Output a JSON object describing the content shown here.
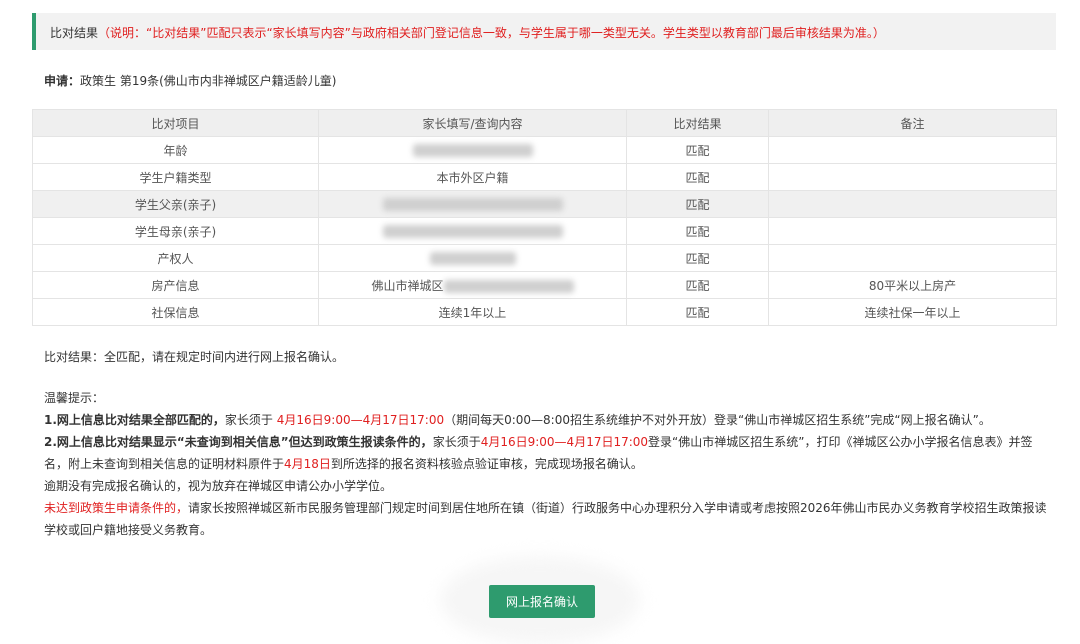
{
  "header": {
    "title": "比对结果",
    "note": "（说明：“比对结果”匹配只表示“家长填写内容”与政府相关部门登记信息一致，与学生属于哪一类型无关。学生类型以教育部门最后审核结果为准。）"
  },
  "apply": {
    "label": "申请：",
    "value": "政策生 第19条(佛山市内非禅城区户籍适龄儿童)"
  },
  "table": {
    "columns": [
      "比对项目",
      "家长填写/查询内容",
      "比对结果",
      "备注"
    ],
    "rows": [
      {
        "item": "年龄",
        "content": "",
        "result": "匹配",
        "remark": ""
      },
      {
        "item": "学生户籍类型",
        "content": "本市外区户籍",
        "result": "匹配",
        "remark": ""
      },
      {
        "item": "学生父亲(亲子)",
        "content": "",
        "result": "匹配",
        "remark": ""
      },
      {
        "item": "学生母亲(亲子)",
        "content": "",
        "result": "匹配",
        "remark": ""
      },
      {
        "item": "产权人",
        "content": "",
        "result": "匹配",
        "remark": ""
      },
      {
        "item": "房产信息",
        "content": "佛山市禅城区",
        "result": "匹配",
        "remark": "80平米以上房产"
      },
      {
        "item": "社保信息",
        "content": "连续1年以上",
        "result": "匹配",
        "remark": "连续社保一年以上"
      }
    ]
  },
  "summary": "比对结果：全匹配，请在规定时间内进行网上报名确认。",
  "tips": {
    "heading": "温馨提示：",
    "t1_bold": "1.网上信息比对结果全部匹配的，",
    "t1_a": "家长须于 ",
    "t1_red": "4月16日9:00—4月17日17:00",
    "t1_b": "（期间每天0:00—8:00招生系统维护不对外开放）登录“佛山市禅城区招生系统”完成“网上报名确认”。",
    "t2_bold": "2.网上信息比对结果显示“未查询到相关信息”但达到政策生报读条件的，",
    "t2_a": "家长须于",
    "t2_red1": "4月16日9:00—4月17日17:00",
    "t2_b": "登录“佛山市禅城区招生系统”，打印《禅城区公办小学报名信息表》并签名，附上未查询到相关信息的证明材料原件于",
    "t2_red2": "4月18日",
    "t2_c": "到所选择的报名资料核验点验证审核，完成现场报名确认。",
    "t3": "逾期没有完成报名确认的，视为放弃在禅城区申请公办小学学位。",
    "t4_red": "未达到政策生申请条件的，",
    "t4_b": "请家长按照禅城区新市民服务管理部门规定时间到居住地所在镇（街道）行政服务中心办理积分入学申请或考虑按照2026年佛山市民办义务教育学校招生政策报读学校或回户籍地接受义务教育。"
  },
  "button": {
    "label": "网上报名确认"
  },
  "colors": {
    "accent": "#2e9b6e",
    "warning": "#e02020",
    "match": "#2a8b2a"
  }
}
